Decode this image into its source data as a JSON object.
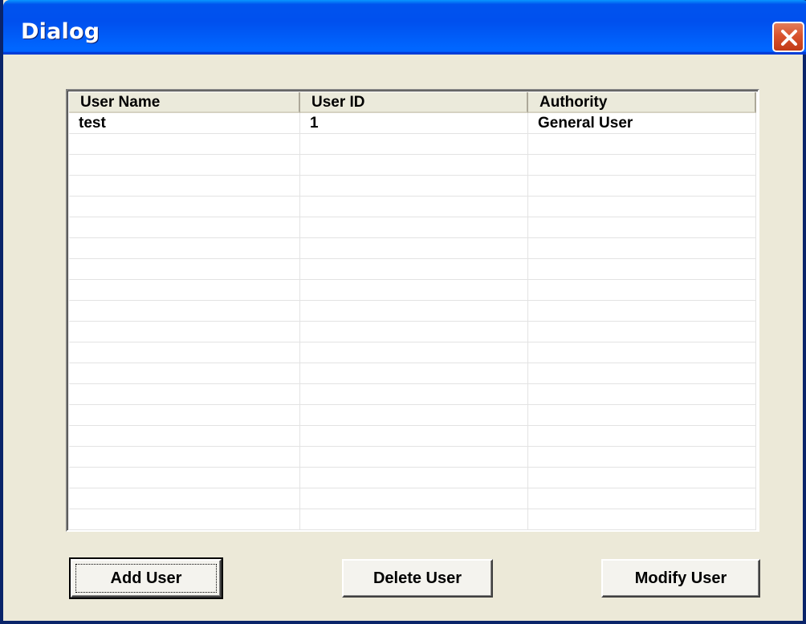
{
  "window": {
    "title": "Dialog",
    "close_icon": "close-icon",
    "accent": "#0053ee",
    "close_color": "#d9532d"
  },
  "list": {
    "columns": [
      "User Name",
      "User ID",
      "Authority"
    ],
    "rows": [
      [
        "test",
        "1",
        "General User"
      ],
      [
        "",
        "",
        ""
      ],
      [
        "",
        "",
        ""
      ],
      [
        "",
        "",
        ""
      ],
      [
        "",
        "",
        ""
      ],
      [
        "",
        "",
        ""
      ],
      [
        "",
        "",
        ""
      ],
      [
        "",
        "",
        ""
      ],
      [
        "",
        "",
        ""
      ],
      [
        "",
        "",
        ""
      ],
      [
        "",
        "",
        ""
      ],
      [
        "",
        "",
        ""
      ],
      [
        "",
        "",
        ""
      ],
      [
        "",
        "",
        ""
      ],
      [
        "",
        "",
        ""
      ],
      [
        "",
        "",
        ""
      ],
      [
        "",
        "",
        ""
      ],
      [
        "",
        "",
        ""
      ],
      [
        "",
        "",
        ""
      ],
      [
        "",
        "",
        ""
      ]
    ]
  },
  "buttons": {
    "add": "Add User",
    "delete": "Delete User",
    "modify": "Modify User"
  }
}
